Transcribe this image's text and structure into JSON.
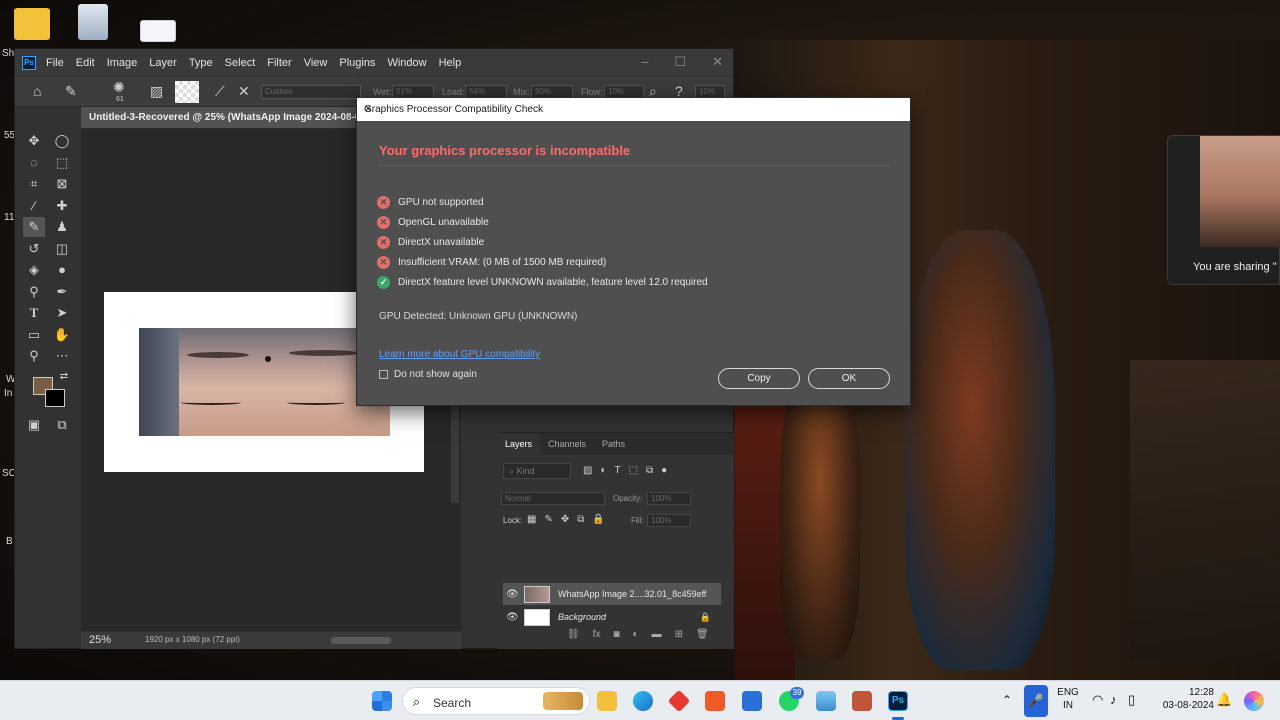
{
  "photoshop": {
    "menu": [
      "File",
      "Edit",
      "Image",
      "Layer",
      "Type",
      "Select",
      "Filter",
      "View",
      "Plugins",
      "Window",
      "Help"
    ],
    "options": {
      "brush_size": "61",
      "preset": "Custom",
      "wet_label": "Wet:",
      "wet_value": "51%",
      "load_label": "Load:",
      "load_value": "54%",
      "mix_label": "Mix:",
      "mix_value": "90%",
      "flow_label": "Flow:",
      "flow_value": "10%",
      "extra_value": "10%"
    },
    "document_tab": "Untitled-3-Recovered @ 25% (WhatsApp Image 2024-08-01 at",
    "status": {
      "zoom": "25%",
      "info": "1920 px x 1080 px (72 ppi)"
    },
    "layers_panel": {
      "tabs": [
        "Layers",
        "Channels",
        "Paths"
      ],
      "kind_placeholder": "Kind",
      "blend_mode": "Normal",
      "opacity_label": "Opacity:",
      "opacity_value": "100%",
      "lock_label": "Lock:",
      "fill_label": "Fill:",
      "fill_value": "100%",
      "layers": [
        {
          "name": "WhatsApp Image 2....32.01_8c459eff"
        },
        {
          "name": "Background"
        }
      ]
    }
  },
  "dialog": {
    "title": "Graphics Processor Compatibility Check",
    "heading": "Your graphics processor is incompatible",
    "checks": [
      {
        "text": "GPU not supported",
        "status": "fail"
      },
      {
        "text": "OpenGL unavailable",
        "status": "fail"
      },
      {
        "text": "DirectX unavailable",
        "status": "fail"
      },
      {
        "text": "Insufficient VRAM: (0 MB of 1500 MB required)",
        "status": "fail"
      },
      {
        "text": "DirectX feature level UNKNOWN available, feature level 12.0 required",
        "status": "pass"
      }
    ],
    "gpu_detected": "GPU Detected: Unknown GPU (UNKNOWN)",
    "learn_more": "Learn more about GPU compatibility",
    "dont_show": "Do not show again",
    "copy_button": "Copy",
    "ok_button": "OK",
    "error_color": "#ff6b6b",
    "pass_color": "#3aa86b"
  },
  "sharing_popup": {
    "text": "You are sharing \""
  },
  "taskbar": {
    "search_label": "Search",
    "whatsapp_badge": "39",
    "language": "ENG",
    "region": "IN",
    "time": "12:28",
    "date": "03-08-2024"
  },
  "desktop": {
    "edge_labels": [
      "Sh",
      "55",
      "11",
      "W",
      "In",
      "SC",
      "B"
    ]
  }
}
